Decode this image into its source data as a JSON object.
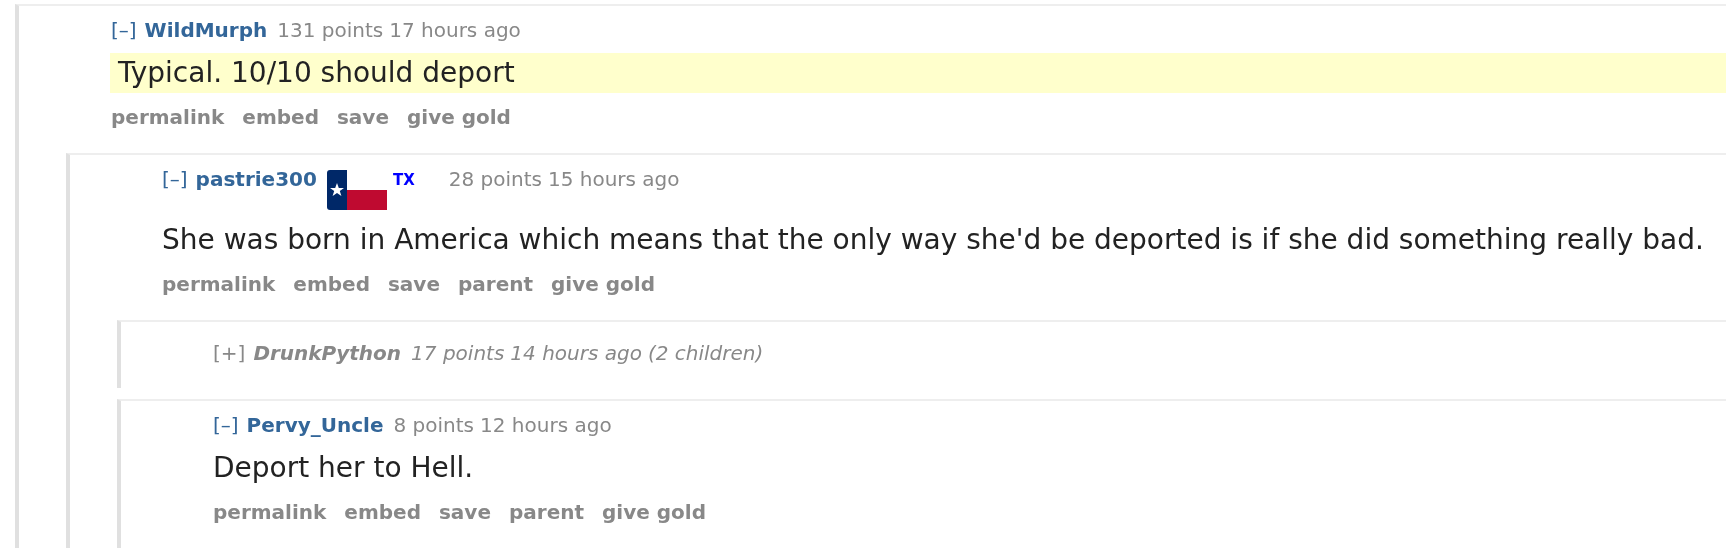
{
  "comments": [
    {
      "toggle": "[–]",
      "author": "WildMurph",
      "score": "131 points",
      "time": "17 hours ago",
      "collapsed": false,
      "highlighted": true,
      "body": "Typical. 10/10 should deport",
      "actions": [
        "permalink",
        "embed",
        "save",
        "give gold"
      ],
      "children": [
        {
          "toggle": "[–]",
          "author": "pastrie300",
          "flair": "TX",
          "score": "28 points",
          "time": "15 hours ago",
          "collapsed": false,
          "highlighted": false,
          "body": "She was born in America which means that the only way she'd be deported is if she did something really bad.",
          "actions": [
            "permalink",
            "embed",
            "save",
            "parent",
            "give gold"
          ],
          "children": [
            {
              "toggle": "[+]",
              "author": "DrunkPython",
              "score": "17 points",
              "time": "14 hours ago",
              "child_count": "(2 children)",
              "collapsed": true
            },
            {
              "toggle": "[–]",
              "author": "Pervy_Uncle",
              "score": "8 points",
              "time": "12 hours ago",
              "collapsed": false,
              "highlighted": false,
              "body": "Deport her to Hell.",
              "actions": [
                "permalink",
                "embed",
                "save",
                "parent",
                "give gold"
              ]
            }
          ]
        }
      ]
    }
  ]
}
